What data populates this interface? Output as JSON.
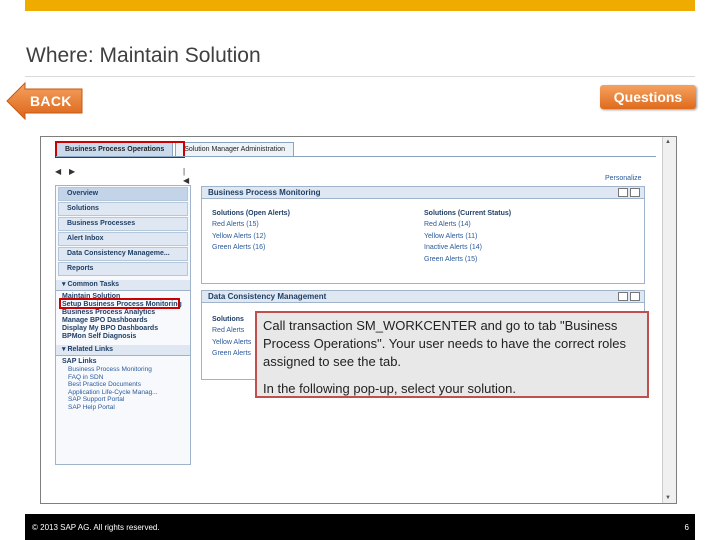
{
  "slide": {
    "title": "Where: Maintain Solution",
    "back_label": "BACK",
    "questions_label": "Questions",
    "accent_color": "#f0ab00",
    "highlight_color": "#cc0000"
  },
  "screenshot": {
    "tabs": [
      "Business Process Operations",
      "Solution Manager Administration"
    ],
    "personalize": "Personalize",
    "nav": {
      "items": [
        "Overview",
        "Solutions",
        "Business Processes",
        "Alert Inbox",
        "Data Consistency Manageme...",
        "Reports"
      ],
      "common_tasks_title": "Common Tasks",
      "common_tasks": [
        "Maintain Solution",
        "Setup Business Process Monitoring",
        "Business Process Analytics",
        "Manage BPO Dashboards",
        "Display My BPO Dashboards",
        "BPMon Self Diagnosis"
      ],
      "related_title": "Related Links",
      "related_group": "SAP Links",
      "related_links": [
        "Business Process Monitoring",
        "FAQ in SDN",
        "Best Practice Documents",
        "Application Life-Cycle Manag...",
        "SAP Support Portal",
        "SAP Help Portal"
      ]
    },
    "bpm_panel": {
      "title": "Business Process Monitoring",
      "open_alerts_title": "Solutions (Open Alerts)",
      "open_alerts": [
        "Red Alerts (15)",
        "Yellow Alerts (12)",
        "Green Alerts (16)"
      ],
      "status_title": "Solutions (Current Status)",
      "status": [
        "Red Alerts (14)",
        "Yellow Alerts (11)",
        "Inactive Alerts (14)",
        "Green Alerts (15)"
      ]
    },
    "dcm_panel": {
      "title": "Data Consistency Management",
      "col_title": "Solutions",
      "alerts": [
        "Red Alerts",
        "Yellow Alerts",
        "Green Alerts"
      ]
    }
  },
  "callout": {
    "line1": "Call transaction SM_WORKCENTER and go to tab \"Business Process Operations\". Your user needs to have the correct roles assigned to see the tab.",
    "line2": "In the following pop-up, select your solution."
  },
  "footer": {
    "copyright": "© 2013 SAP AG. All rights reserved.",
    "page": "6"
  }
}
